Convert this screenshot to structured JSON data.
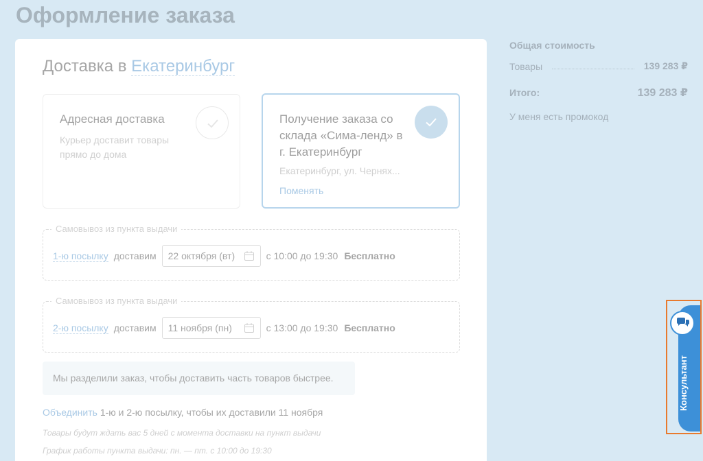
{
  "page": {
    "title": "Оформление заказа"
  },
  "delivery": {
    "heading_prefix": "Доставка в",
    "city": "Екатеринбург",
    "options": [
      {
        "title": "Адресная доставка",
        "subtitle": "Курьер доставит товары прямо до дома",
        "selected": false
      },
      {
        "title": "Получение заказа со склада «Сима-ленд» в г. Екатеринбург",
        "address": "Екатеринбург, ул. Чернях...",
        "change_label": "Поменять",
        "selected": true
      }
    ]
  },
  "parcels": [
    {
      "legend": "Самовывоз из пункта выдачи",
      "link": "1-ю посылку",
      "verb": "доставим",
      "date": "22 октября (вт)",
      "time": "с 10:00 до 19:30",
      "price": "Бесплатно"
    },
    {
      "legend": "Самовывоз из пункта выдачи",
      "link": "2-ю посылку",
      "verb": "доставим",
      "date": "11 ноября (пн)",
      "time": "с 13:00 до 19:30",
      "price": "Бесплатно"
    }
  ],
  "notice": "Мы разделили заказ, чтобы доставить часть товаров быстрее.",
  "merge": {
    "link": "Объединить",
    "text": "1-ю и 2-ю посылку, чтобы их доставили 11 ноября"
  },
  "notes": [
    "Товары будут ждать вас 5 дней с момента доставки на пункт выдачи",
    "График работы пункта выдачи: пн. — пт. с 10:00 до 19:30"
  ],
  "summary": {
    "title": "Общая стоимость",
    "goods_label": "Товары",
    "goods_value": "139 283 ₽",
    "total_label": "Итого:",
    "total_value": "139 283 ₽",
    "promo_label": "У меня есть промокод"
  },
  "consultant": {
    "label": "Консультант"
  },
  "colors": {
    "accent": "#a9c9e5",
    "consultant": "#3d90d8",
    "highlight": "#e87a2e"
  }
}
